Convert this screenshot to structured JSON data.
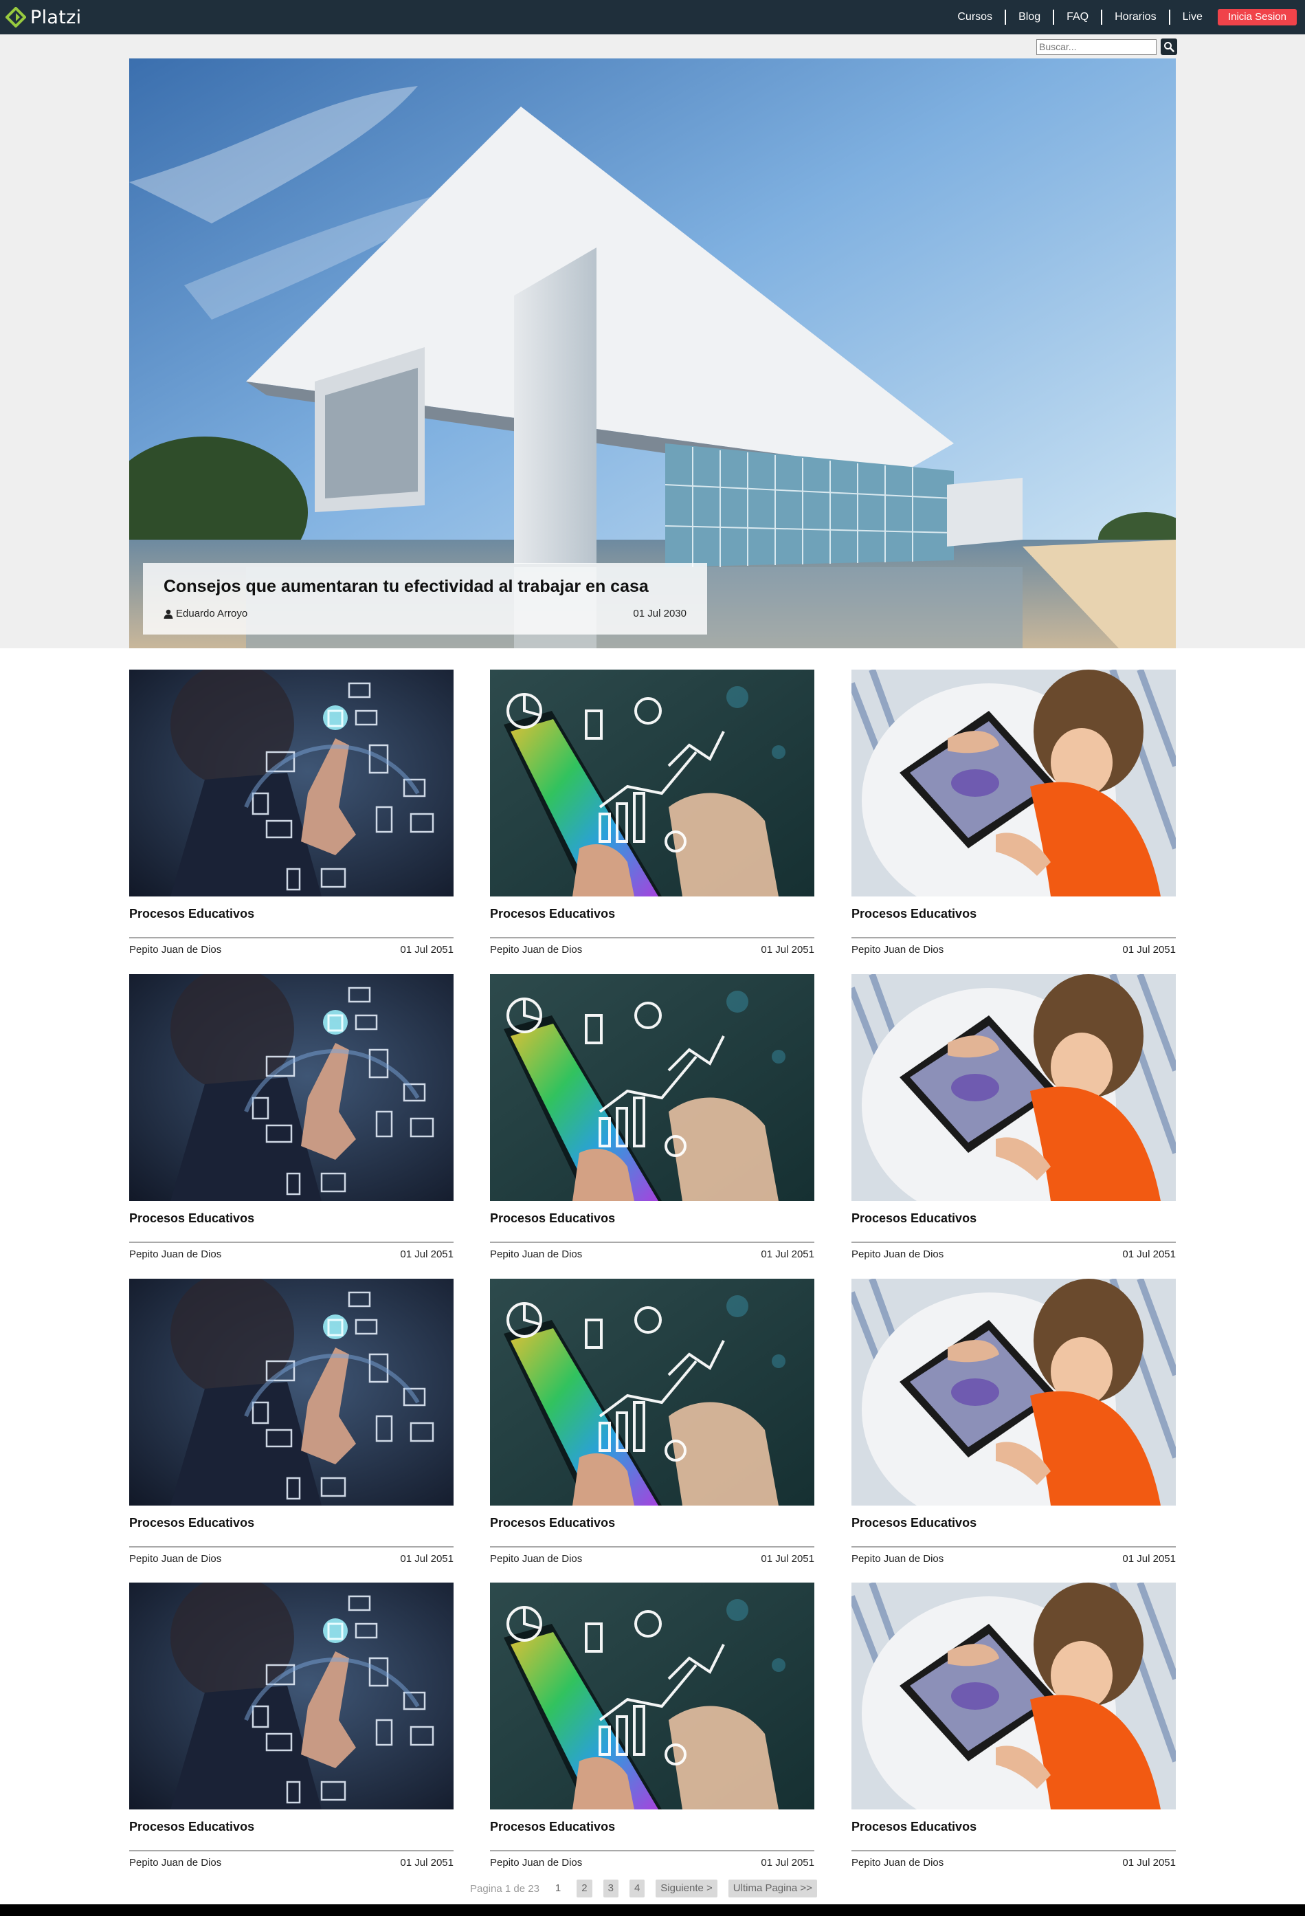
{
  "brand": {
    "name": "Platzi",
    "accent": "#98ca3f",
    "topbar_color": "#1f2f3b"
  },
  "nav": {
    "items": [
      "Cursos",
      "Blog",
      "FAQ",
      "Horarios",
      "Live"
    ],
    "login_label": "Inicia Sesion",
    "login_color": "#f0434a"
  },
  "search": {
    "placeholder": "Buscar...",
    "icon": "search-icon"
  },
  "featured": {
    "title": "Consejos que aumentaran tu efectividad al trabajar en casa",
    "author": "Eduardo Arroyo",
    "date": "01 Jul 2030",
    "author_icon": "user-icon"
  },
  "posts": [
    {
      "title": "Procesos Educativos",
      "author": "Pepito Juan de Dios",
      "date": "01 Jul 2051",
      "image": "touch-network-image"
    },
    {
      "title": "Procesos Educativos",
      "author": "Pepito Juan de Dios",
      "date": "01 Jul 2051",
      "image": "phone-graphs-image"
    },
    {
      "title": "Procesos Educativos",
      "author": "Pepito Juan de Dios",
      "date": "01 Jul 2051",
      "image": "child-tablet-image"
    },
    {
      "title": "Procesos Educativos",
      "author": "Pepito Juan de Dios",
      "date": "01 Jul 2051",
      "image": "touch-network-image"
    },
    {
      "title": "Procesos Educativos",
      "author": "Pepito Juan de Dios",
      "date": "01 Jul 2051",
      "image": "phone-graphs-image"
    },
    {
      "title": "Procesos Educativos",
      "author": "Pepito Juan de Dios",
      "date": "01 Jul 2051",
      "image": "child-tablet-image"
    },
    {
      "title": "Procesos Educativos",
      "author": "Pepito Juan de Dios",
      "date": "01 Jul 2051",
      "image": "touch-network-image"
    },
    {
      "title": "Procesos Educativos",
      "author": "Pepito Juan de Dios",
      "date": "01 Jul 2051",
      "image": "phone-graphs-image"
    },
    {
      "title": "Procesos Educativos",
      "author": "Pepito Juan de Dios",
      "date": "01 Jul 2051",
      "image": "child-tablet-image"
    },
    {
      "title": "Procesos Educativos",
      "author": "Pepito Juan de Dios",
      "date": "01 Jul 2051",
      "image": "touch-network-image"
    },
    {
      "title": "Procesos Educativos",
      "author": "Pepito Juan de Dios",
      "date": "01 Jul 2051",
      "image": "phone-graphs-image"
    },
    {
      "title": "Procesos Educativos",
      "author": "Pepito Juan de Dios",
      "date": "01 Jul 2051",
      "image": "child-tablet-image"
    }
  ],
  "pagination": {
    "info": "Pagina 1 de 23",
    "pages": [
      "1",
      "2",
      "3",
      "4"
    ],
    "next": "Siguiente >",
    "last": "Ultima Pagina >>"
  }
}
